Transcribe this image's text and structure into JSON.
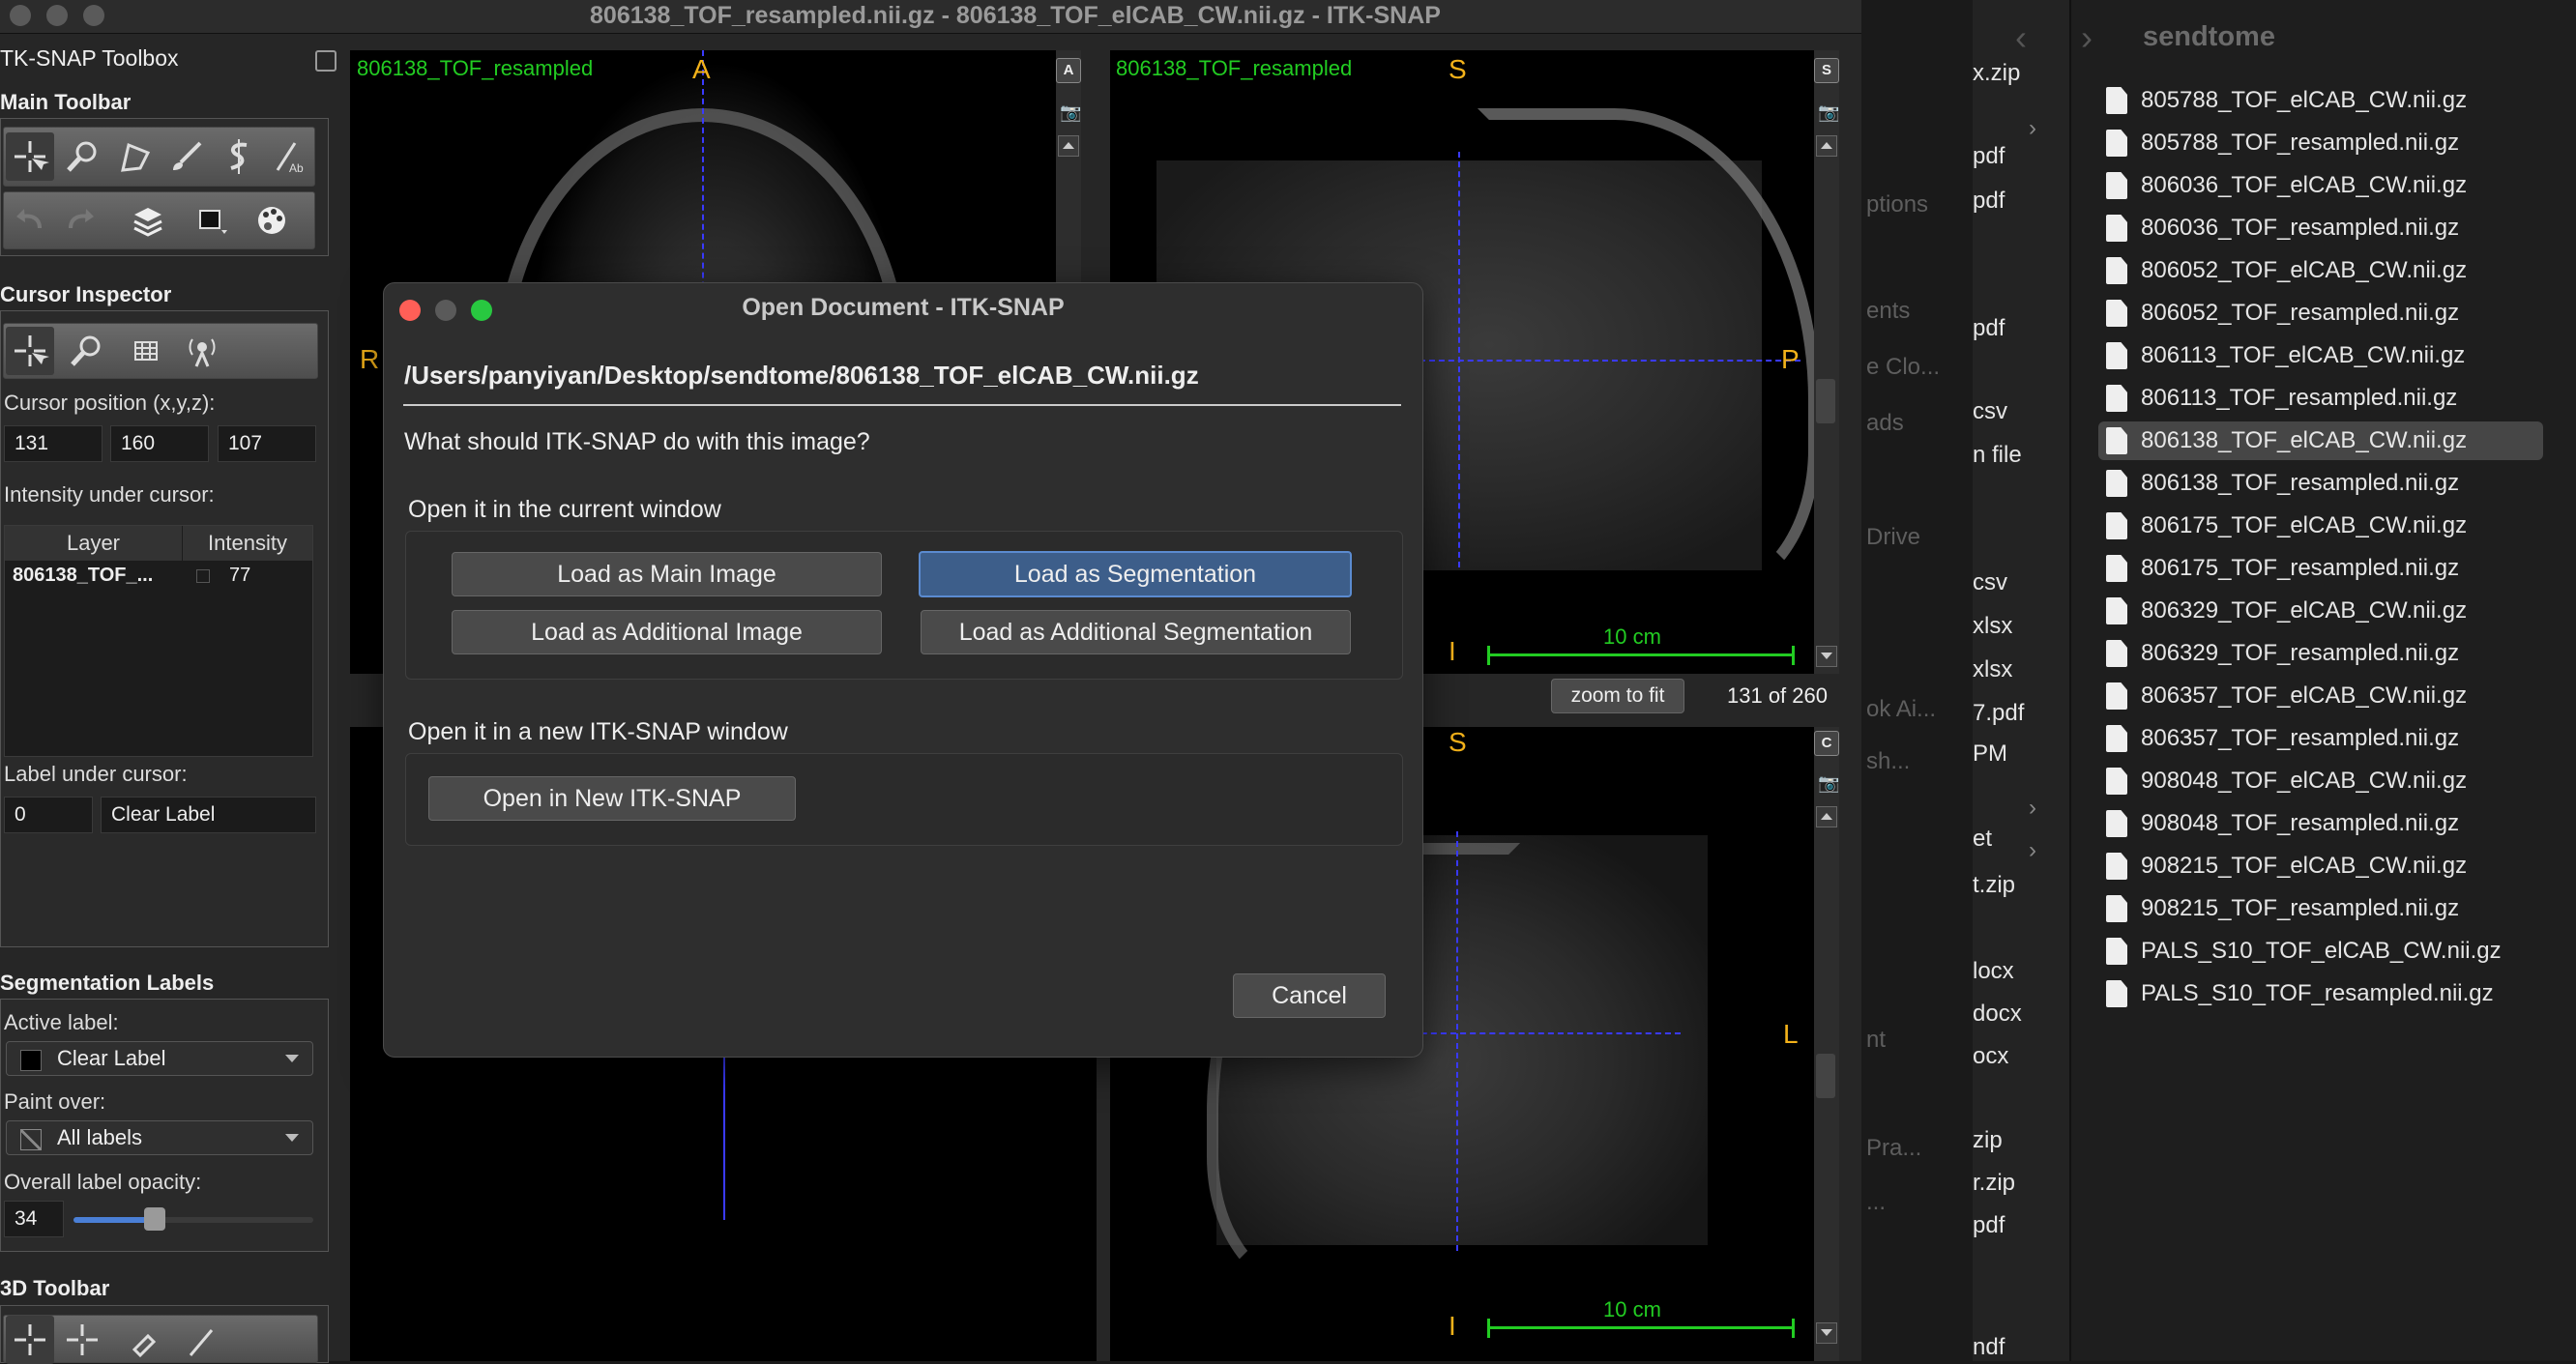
{
  "window": {
    "title": "806138_TOF_resampled.nii.gz - 806138_TOF_elCAB_CW.nii.gz - ITK-SNAP"
  },
  "toolbox": {
    "title": "TK-SNAP Toolbox",
    "main_toolbar": "Main Toolbar",
    "cursor_inspector": "Cursor Inspector",
    "cursor_position_label": "Cursor position (x,y,z):",
    "cursor_x": "131",
    "cursor_y": "160",
    "cursor_z": "107",
    "intensity_label": "Intensity under cursor:",
    "table_headers": [
      "Layer",
      "Intensity"
    ],
    "table_rows": [
      {
        "layer": "806138_TOF_...",
        "intensity": "77"
      }
    ],
    "label_under_cursor": "Label under cursor:",
    "label_id": "0",
    "label_name": "Clear Label",
    "seg_labels_title": "Segmentation Labels",
    "active_label": "Active label:",
    "active_label_value": "Clear Label",
    "paint_over": "Paint over:",
    "paint_over_value": "All labels",
    "opacity_label": "Overall label opacity:",
    "opacity_value": "34",
    "toolbar_3d": "3D Toolbar"
  },
  "viewers": {
    "axial_label": "806138_TOF_resampled",
    "sagittal_label": "806138_TOF_resampled",
    "orient_A": "A",
    "orient_R": "R",
    "orient_S": "S",
    "orient_P": "P",
    "orient_I": "I",
    "orient_L": "L",
    "scale_label_top": "10 cm",
    "scale_label_bottom": "10 cm",
    "zoom_to_fit": "zoom to fit",
    "slice_counter": "131 of 260",
    "corner_icon_A": "A",
    "corner_icon_S": "S",
    "corner_icon_C": "C"
  },
  "dialog": {
    "title": "Open Document - ITK-SNAP",
    "path": "/Users/panyiyan/Desktop/sendtome/806138_TOF_elCAB_CW.nii.gz",
    "question": "What should ITK-SNAP do with this image?",
    "current_window_heading": "Open it in the current window",
    "btn_main_image": "Load as Main Image",
    "btn_segmentation": "Load as Segmentation",
    "btn_additional_image": "Load as Additional Image",
    "btn_additional_segmentation": "Load as Additional Segmentation",
    "new_window_heading": "Open it in a new ITK-SNAP window",
    "btn_new_itksnap": "Open in New ITK-SNAP",
    "btn_cancel": "Cancel"
  },
  "finder": {
    "folder_title": "sendtome",
    "sidebar_partial": [
      "x.zip",
      "pdf",
      "pdf",
      "pdf",
      "csv",
      "n file",
      "csv",
      "xlsx",
      "xlsx",
      "7.pdf",
      "PM",
      "et",
      "t.zip",
      "locx",
      "docx",
      "ocx",
      "zip",
      "r.zip",
      "pdf",
      "ndf"
    ],
    "behind_partial": [
      "ptions",
      "ents",
      "e Clo...",
      "ads",
      "Drive",
      "ok Ai...",
      "sh...",
      "nt",
      "Pra...",
      "..."
    ],
    "files": [
      "805788_TOF_elCAB_CW.nii.gz",
      "805788_TOF_resampled.nii.gz",
      "806036_TOF_elCAB_CW.nii.gz",
      "806036_TOF_resampled.nii.gz",
      "806052_TOF_elCAB_CW.nii.gz",
      "806052_TOF_resampled.nii.gz",
      "806113_TOF_elCAB_CW.nii.gz",
      "806113_TOF_resampled.nii.gz",
      "806138_TOF_elCAB_CW.nii.gz",
      "806138_TOF_resampled.nii.gz",
      "806175_TOF_elCAB_CW.nii.gz",
      "806175_TOF_resampled.nii.gz",
      "806329_TOF_elCAB_CW.nii.gz",
      "806329_TOF_resampled.nii.gz",
      "806357_TOF_elCAB_CW.nii.gz",
      "806357_TOF_resampled.nii.gz",
      "908048_TOF_elCAB_CW.nii.gz",
      "908048_TOF_resampled.nii.gz",
      "908215_TOF_elCAB_CW.nii.gz",
      "908215_TOF_resampled.nii.gz",
      "PALS_S10_TOF_elCAB_CW.nii.gz",
      "PALS_S10_TOF_resampled.nii.gz"
    ],
    "selected_file": "806138_TOF_elCAB_CW.nii.gz"
  },
  "colors": {
    "accent": "#5b8bd0",
    "overlay_text": "#22cc22",
    "orientation": "#f3b21a",
    "crosshair": "#3a3aff"
  }
}
